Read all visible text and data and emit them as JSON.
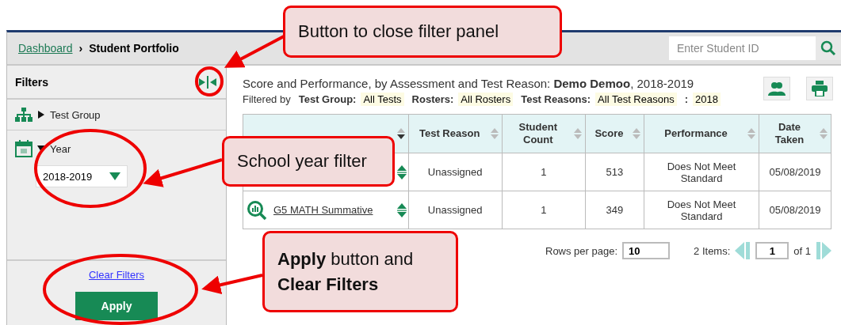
{
  "breadcrumb": {
    "link": "Dashboard",
    "separator": "›",
    "current": "Student Portfolio"
  },
  "search": {
    "placeholder": "Enter Student ID"
  },
  "filters": {
    "title": "Filters",
    "groups": [
      {
        "kind": "tree",
        "label": "Test Group",
        "expanded": false
      },
      {
        "kind": "calendar",
        "label": "Year",
        "expanded": true,
        "value": "2018-2019"
      }
    ],
    "clear": "Clear Filters",
    "apply": "Apply"
  },
  "report": {
    "title": "Score and Performance, by Assessment and Test Reason: **Demo Demoo**, 2018-2019",
    "filtered_by": "Filtered by",
    "filter_tags": [
      {
        "label": "Test Group:",
        "value": "All Tests"
      },
      {
        "label": "Rosters:",
        "value": "All Rosters"
      },
      {
        "label": "Test Reasons:",
        "value": "All Test Reasons"
      },
      {
        "label": ":",
        "value": "2018"
      }
    ]
  },
  "table": {
    "columns": [
      {
        "sorted": true
      },
      {
        "label": "Test Reason",
        "sorted": false
      },
      {
        "label": "Student Count",
        "sorted": false
      },
      {
        "label": "Score",
        "sorted": false
      },
      {
        "label": "Performance",
        "sorted": false
      },
      {
        "label": "Date Taken",
        "sorted": false
      }
    ],
    "rows": [
      {
        "reason": "Unassigned",
        "count": "1",
        "score": "513",
        "performance": "Does Not Meet Standard",
        "date": "05/08/2019"
      },
      {
        "name": "G5 MATH Summative",
        "reason": "Unassigned",
        "count": "1",
        "score": "349",
        "performance": "Does Not Meet Standard",
        "date": "05/08/2019"
      }
    ]
  },
  "pagination": {
    "rows_label": "Rows per page:",
    "rows_value": "10",
    "items": "2 Items:",
    "page": "1",
    "of": "of 1"
  },
  "callouts": [
    {
      "text": "Button to close filter panel"
    },
    {
      "text": "School year filter"
    },
    {
      "text": "**Apply** button and **Clear Filters**"
    }
  ]
}
